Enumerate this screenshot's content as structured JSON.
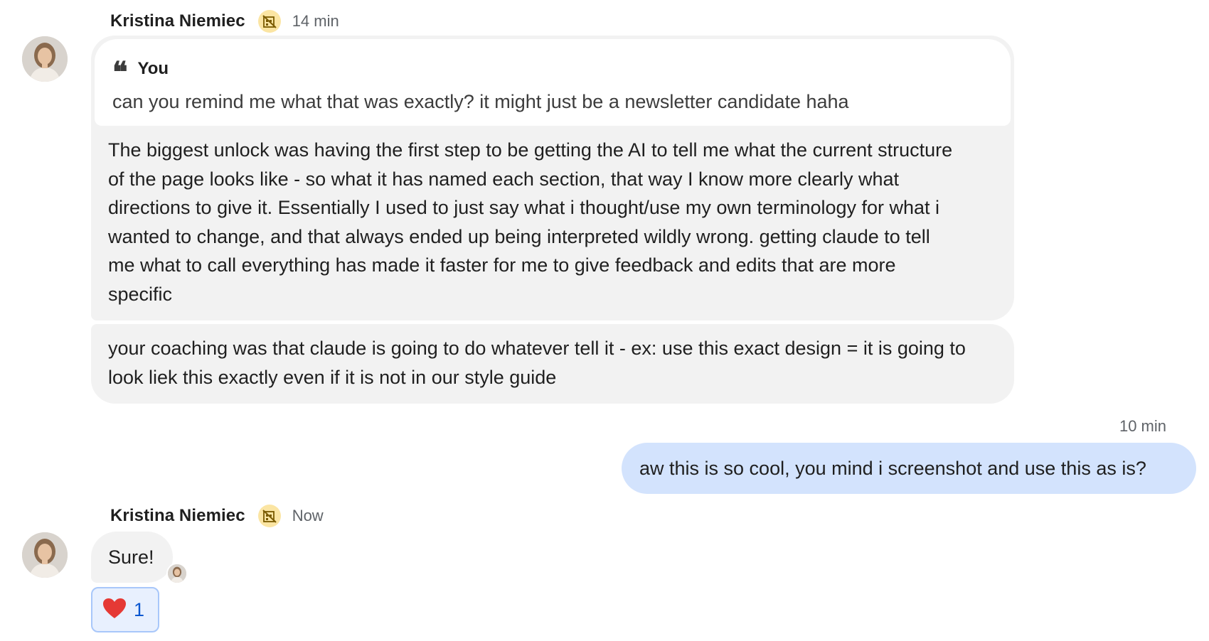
{
  "messages": {
    "first": {
      "sender": "Kristina Niemiec",
      "time": "14 min",
      "quote_author": "You",
      "quote_text": "can you remind me what that was exactly? it might just be a newsletter candidate haha",
      "text": "The biggest unlock was having the first step to be getting the AI to tell me what the current structure of the page looks like - so what it has named each section, that way I know more clearly what directions to give it. Essentially I used to just say what i thought/use my own terminology for what i wanted to change, and that always ended up being interpreted wildly wrong. getting claude to tell me what to call everything has made it faster for me to give feedback and edits that are more specific",
      "followup": "your coaching was that claude is going to do whatever tell it - ex: use this exact design = it is going to look liek this exactly even if it is not in our style guide"
    },
    "own": {
      "time": "10 min",
      "text": "aw this is so cool, you mind i screenshot and use this as is?"
    },
    "reply": {
      "sender": "Kristina Niemiec",
      "time": "Now",
      "text": "Sure!",
      "reaction_emoji": "heart",
      "reaction_count": "1"
    }
  },
  "icons": {
    "external_badge": "external-user-badge-icon",
    "quote": "quote-icon",
    "reaction": "heart-icon"
  },
  "colors": {
    "incoming_bubble": "#f2f2f2",
    "outgoing_bubble": "#d3e3fd",
    "badge": "#fbe5a3",
    "reaction_border": "#a8c7fa",
    "reaction_count": "#0b57d0"
  }
}
